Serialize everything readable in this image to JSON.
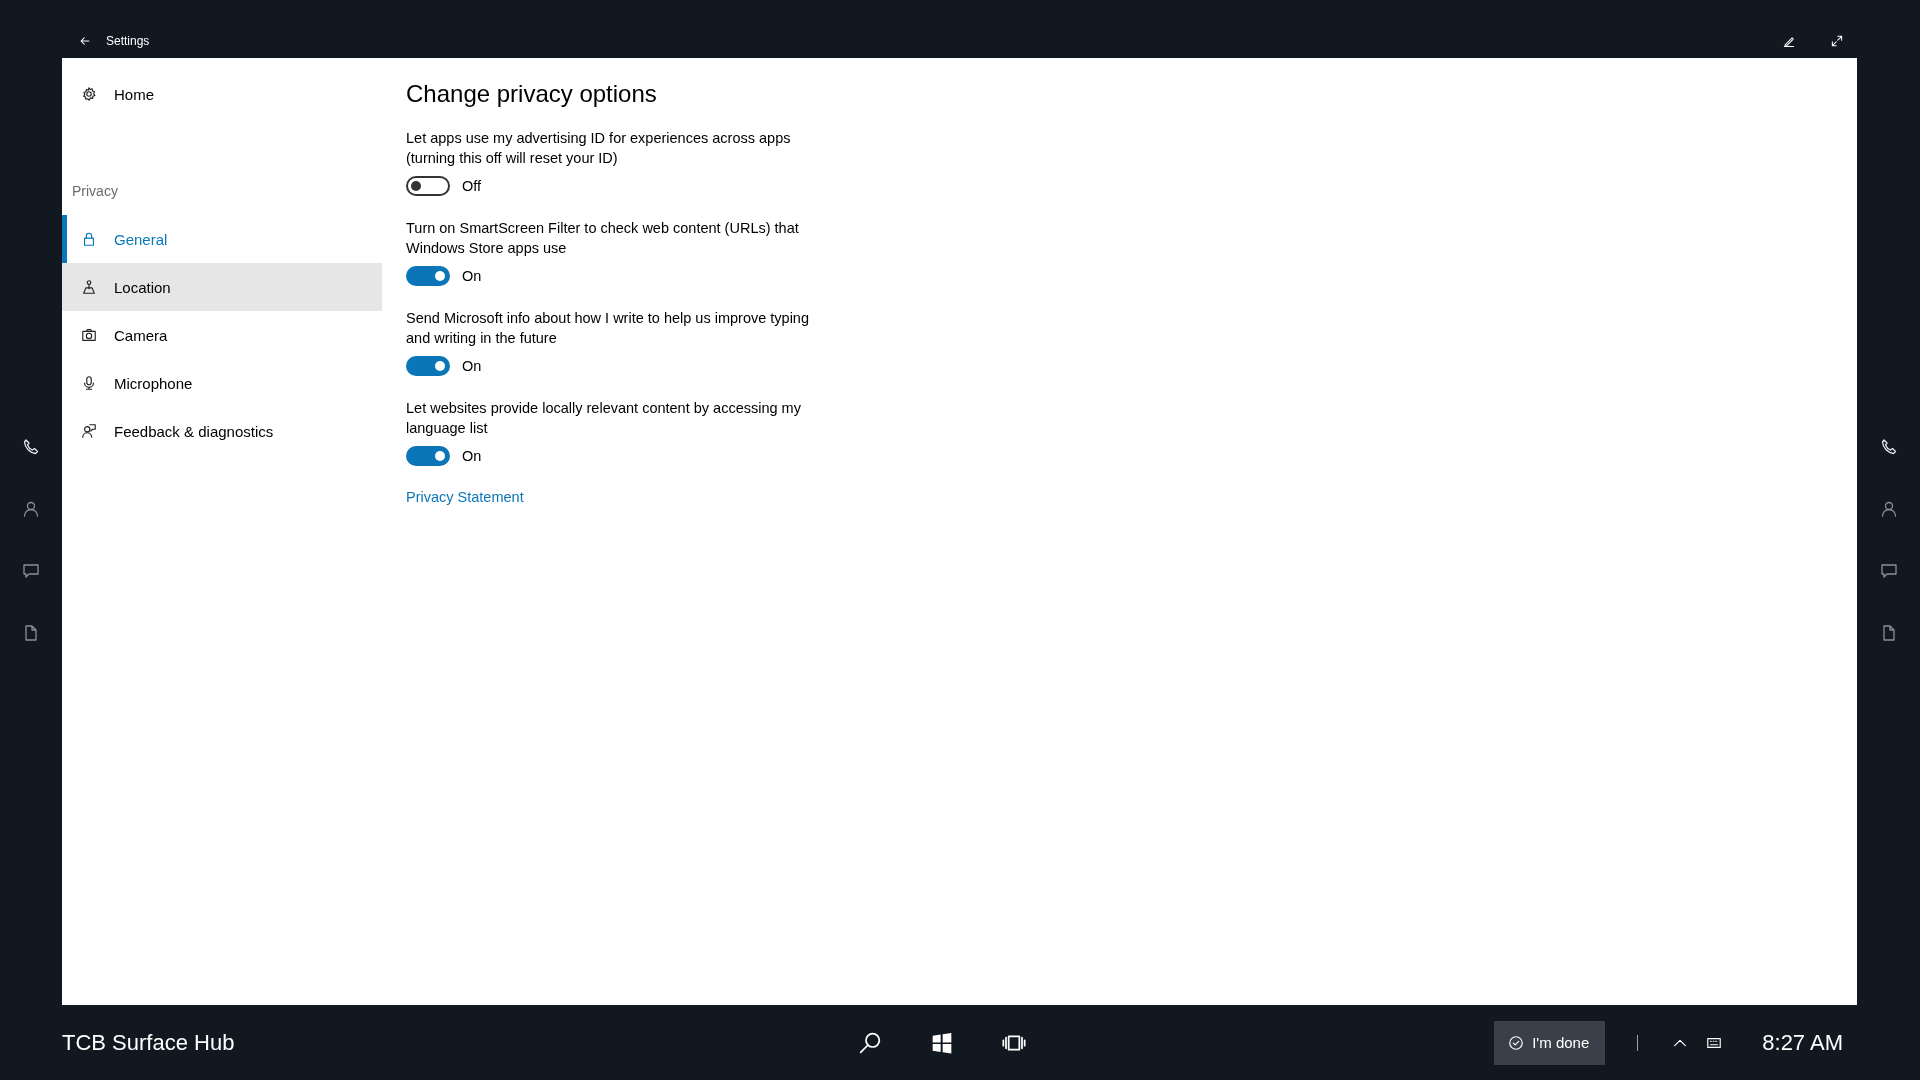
{
  "title_bar": {
    "title": "Settings"
  },
  "sidebar": {
    "home": {
      "label": "Home"
    },
    "section": "Privacy",
    "items": [
      {
        "label": "General",
        "selected": true,
        "hovered": false
      },
      {
        "label": "Location",
        "selected": false,
        "hovered": true
      },
      {
        "label": "Camera",
        "selected": false,
        "hovered": false
      },
      {
        "label": "Microphone",
        "selected": false,
        "hovered": false
      },
      {
        "label": "Feedback & diagnostics",
        "selected": false,
        "hovered": false
      }
    ]
  },
  "content": {
    "heading": "Change privacy options",
    "settings": [
      {
        "description": "Let apps use my advertising ID for experiences across apps (turning this off will reset your ID)",
        "on": false,
        "state_label": "Off"
      },
      {
        "description": "Turn on SmartScreen Filter to check web content (URLs) that Windows Store apps use",
        "on": true,
        "state_label": "On"
      },
      {
        "description": "Send Microsoft info about how I write to help us improve typing and writing in the future",
        "on": true,
        "state_label": "On"
      },
      {
        "description": "Let websites provide locally relevant content by accessing my language list",
        "on": true,
        "state_label": "On"
      }
    ],
    "link": "Privacy Statement"
  },
  "taskbar": {
    "device_name": "TCB Surface Hub",
    "done_button": "I'm done",
    "time": "8:27 AM"
  }
}
